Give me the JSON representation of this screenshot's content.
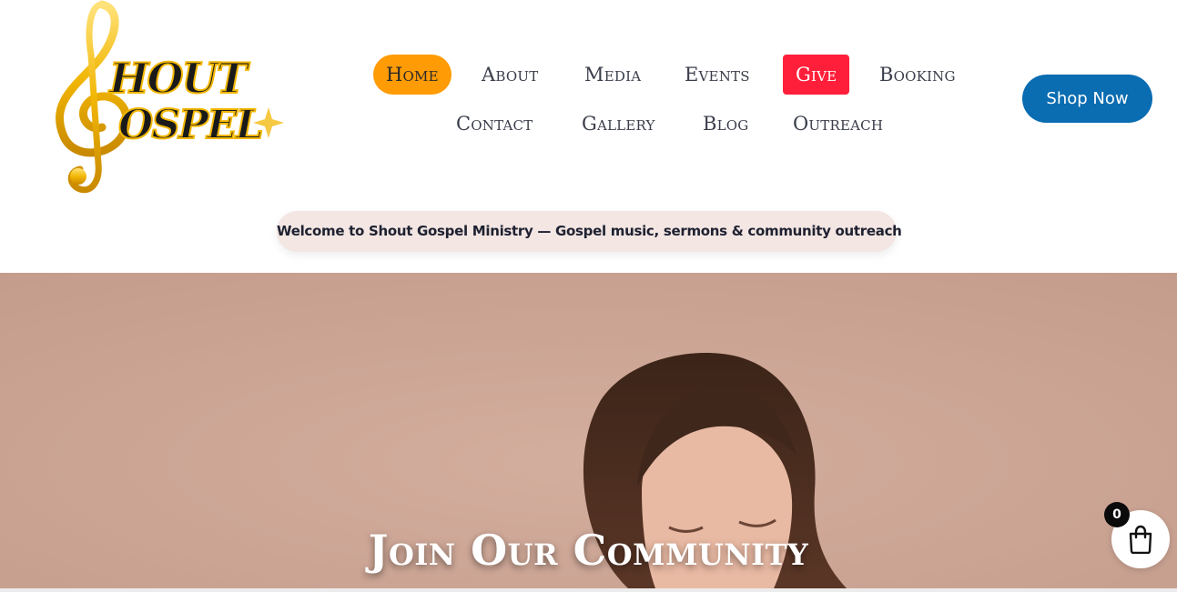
{
  "logo": {
    "alt": "Shout Gospel logo",
    "line1": "HOUT",
    "line2": "OSPEL"
  },
  "nav": {
    "items": [
      {
        "label": "Home"
      },
      {
        "label": "About"
      },
      {
        "label": "Media"
      },
      {
        "label": "Events"
      },
      {
        "label": "Give"
      },
      {
        "label": "Booking"
      },
      {
        "label": "Contact"
      },
      {
        "label": "Gallery"
      },
      {
        "label": "Blog"
      },
      {
        "label": "Outreach"
      }
    ],
    "active": "Home"
  },
  "header": {
    "shop_label": "Shop Now"
  },
  "banner": {
    "text": "Welcome to Shout Gospel Ministry — Gospel music, sermons & community outreach"
  },
  "hero": {
    "title": "Join Our Community"
  },
  "cart": {
    "count": "0",
    "icon": "shopping-bag-icon"
  },
  "colors": {
    "active_nav": "#ff9b05",
    "give": "#ff1f3a",
    "shop_button": "#0a6cb1",
    "banner_bg": "#f3e6e3",
    "hero_bg": "#c9a495"
  }
}
